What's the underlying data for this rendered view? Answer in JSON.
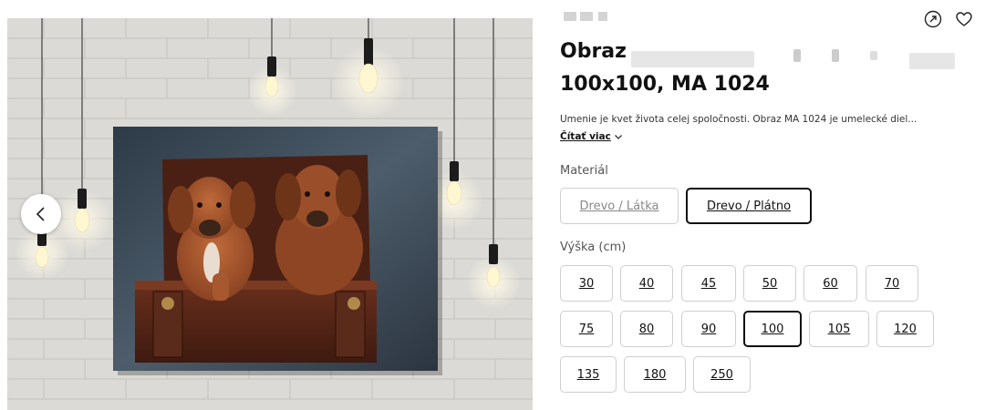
{
  "product": {
    "brand": "",
    "title_line1": "Obraz",
    "title_line2": "100x100, MA 1024",
    "description": "Umenie je kvet života celej spoločnosti. Obraz MA 1024 je umelecké diel...",
    "read_more": "Čítať viac"
  },
  "gallery": {
    "prev_label": "<"
  },
  "material": {
    "label": "Materiál",
    "options": [
      "Drevo / Látka",
      "Drevo / Plátno"
    ],
    "selected": "Drevo / Plátno"
  },
  "height": {
    "label": "Výška (cm)",
    "options": [
      "30",
      "40",
      "45",
      "50",
      "60",
      "70",
      "75",
      "80",
      "90",
      "100",
      "105",
      "120",
      "135",
      "180",
      "250"
    ],
    "selected": "100"
  },
  "icons": {
    "share": "share-icon",
    "favorite": "heart-icon",
    "prev": "chevron-left-icon",
    "read_more": "chevron-down-icon"
  },
  "colors": {
    "accent": "#111111",
    "border": "#cfcfcf",
    "wall": "#d9d7d3"
  }
}
